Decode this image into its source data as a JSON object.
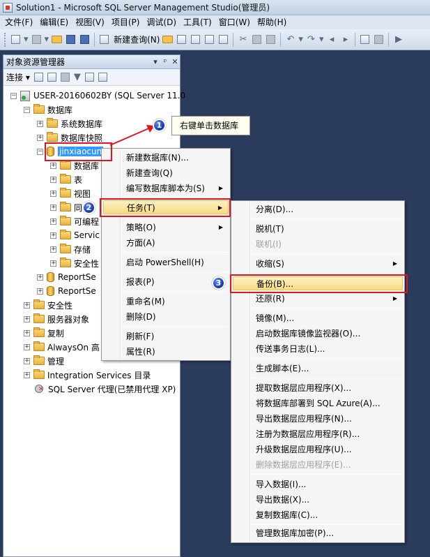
{
  "window": {
    "title": "Solution1 - Microsoft SQL Server Management Studio(管理员)"
  },
  "menubar": [
    "文件(F)",
    "编辑(E)",
    "视图(V)",
    "项目(P)",
    "调试(D)",
    "工具(T)",
    "窗口(W)",
    "帮助(H)"
  ],
  "toolbar": {
    "new_query": "新建查询(N)"
  },
  "object_explorer": {
    "title": "对象资源管理器",
    "pin": "ᵖ",
    "close": "✕",
    "connect": "连接",
    "tree": {
      "server": "USER-20160602BY (SQL Server 11.0",
      "databases": "数据库",
      "system_databases": "系统数据库",
      "snapshots": "数据库快照",
      "selected_db": "jinxiaocun",
      "db_children": [
        "数据库",
        "表",
        "视图",
        "同",
        "可编程",
        "Servic",
        "存储",
        "安全性"
      ],
      "report1": "ReportSe",
      "report2": "ReportSe",
      "security": "安全性",
      "server_objects": "服务器对象",
      "replication": "复制",
      "alwayson": "AlwaysOn 高",
      "management": "管理",
      "integration": "Integration Services 目录",
      "agent": "SQL Server 代理(已禁用代理 XP)"
    }
  },
  "context_menu": {
    "items": [
      "新建数据库(N)...",
      "新建查询(Q)",
      "编写数据库脚本为(S)",
      "任务(T)",
      "策略(O)",
      "方面(A)",
      "启动 PowerShell(H)",
      "报表(P)",
      "重命名(M)",
      "删除(D)",
      "刷新(F)",
      "属性(R)"
    ]
  },
  "tasks_submenu": {
    "items": [
      "分离(D)...",
      "脱机(T)",
      "联机(I)",
      "收缩(S)",
      "备份(B)...",
      "还原(R)",
      "镜像(M)...",
      "启动数据库镜像监视器(O)...",
      "传送事务日志(L)...",
      "生成脚本(E)...",
      "提取数据层应用程序(X)...",
      "将数据库部署到 SQL Azure(A)...",
      "导出数据层应用程序(N)...",
      "注册为数据层应用程序(R)...",
      "升级数据层应用程序(U)...",
      "删除数据层应用程序(E)...",
      "导入数据(I)...",
      "导出数据(X)...",
      "复制数据库(C)...",
      "管理数据库加密(P)..."
    ]
  },
  "annotations": {
    "callout": "右键单击数据库",
    "step1": "1",
    "step2": "2",
    "step3": "3"
  },
  "colors": {
    "highlight": "#f8dc82",
    "annotation_red": "#e0141e",
    "badge_blue": "#1b3fb8",
    "selection": "#3399ff"
  }
}
